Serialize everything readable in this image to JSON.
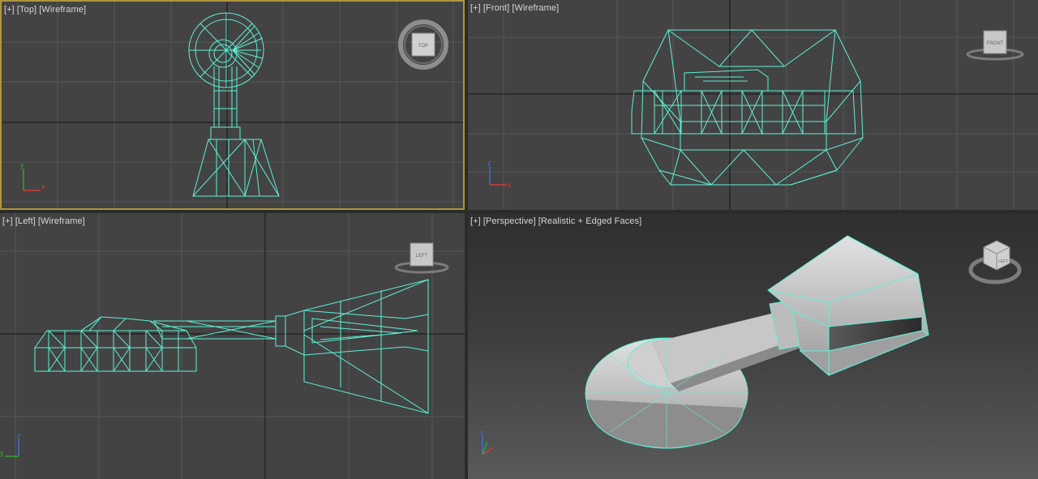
{
  "viewports": {
    "top": {
      "menu": "[+]",
      "view": "[Top]",
      "shading": "[Wireframe]",
      "nav_label": "TOP"
    },
    "front": {
      "menu": "[+]",
      "view": "[Front]",
      "shading": "[Wireframe]",
      "nav_label": "FRONT"
    },
    "left": {
      "menu": "[+]",
      "view": "[Left]",
      "shading": "[Wireframe]",
      "nav_label": "LEFT"
    },
    "perspective": {
      "menu": "[+]",
      "view": "[Perspective]",
      "shading": "[Realistic + Edged Faces]",
      "nav_label": "LEFT"
    }
  },
  "axis_labels": {
    "x": "x",
    "y": "y",
    "z": "z"
  },
  "colors": {
    "wire": "#5ff0d6",
    "grid": "#5a5a5a",
    "axis": "#111111",
    "active_border": "#b09540",
    "viewport_bg": "#434343"
  }
}
